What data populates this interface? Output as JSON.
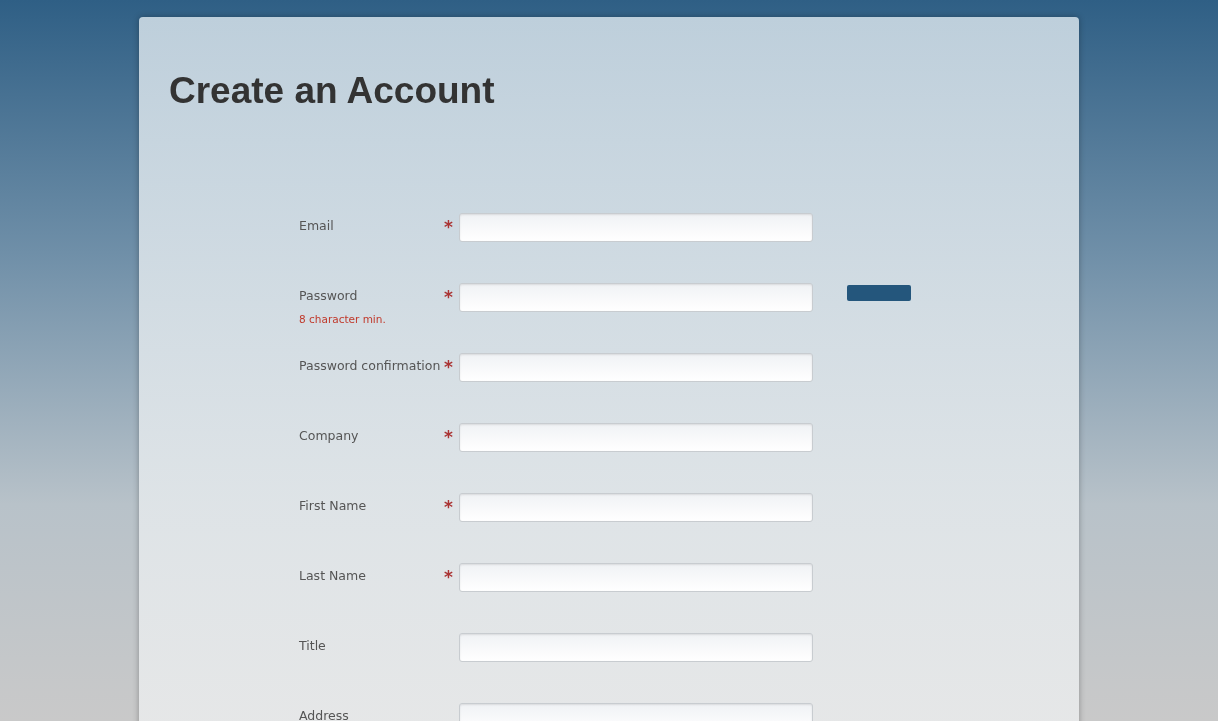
{
  "title": "Create an Account",
  "fields": [
    {
      "kind": "plain",
      "label": "Email",
      "marker": "*"
    },
    {
      "kind": "metered",
      "label": "Password",
      "marker": "*",
      "hint": "8 character min."
    },
    {
      "kind": "plain",
      "label": "Password confirmation",
      "marker": "*"
    },
    {
      "kind": "plain",
      "label": "Company",
      "marker": "*"
    },
    {
      "kind": "plain",
      "label": "First Name",
      "marker": "*"
    },
    {
      "kind": "plain",
      "label": "Last Name",
      "marker": "*"
    },
    {
      "kind": "plain",
      "label": "Title"
    },
    {
      "kind": "plain",
      "label": "Address"
    }
  ]
}
